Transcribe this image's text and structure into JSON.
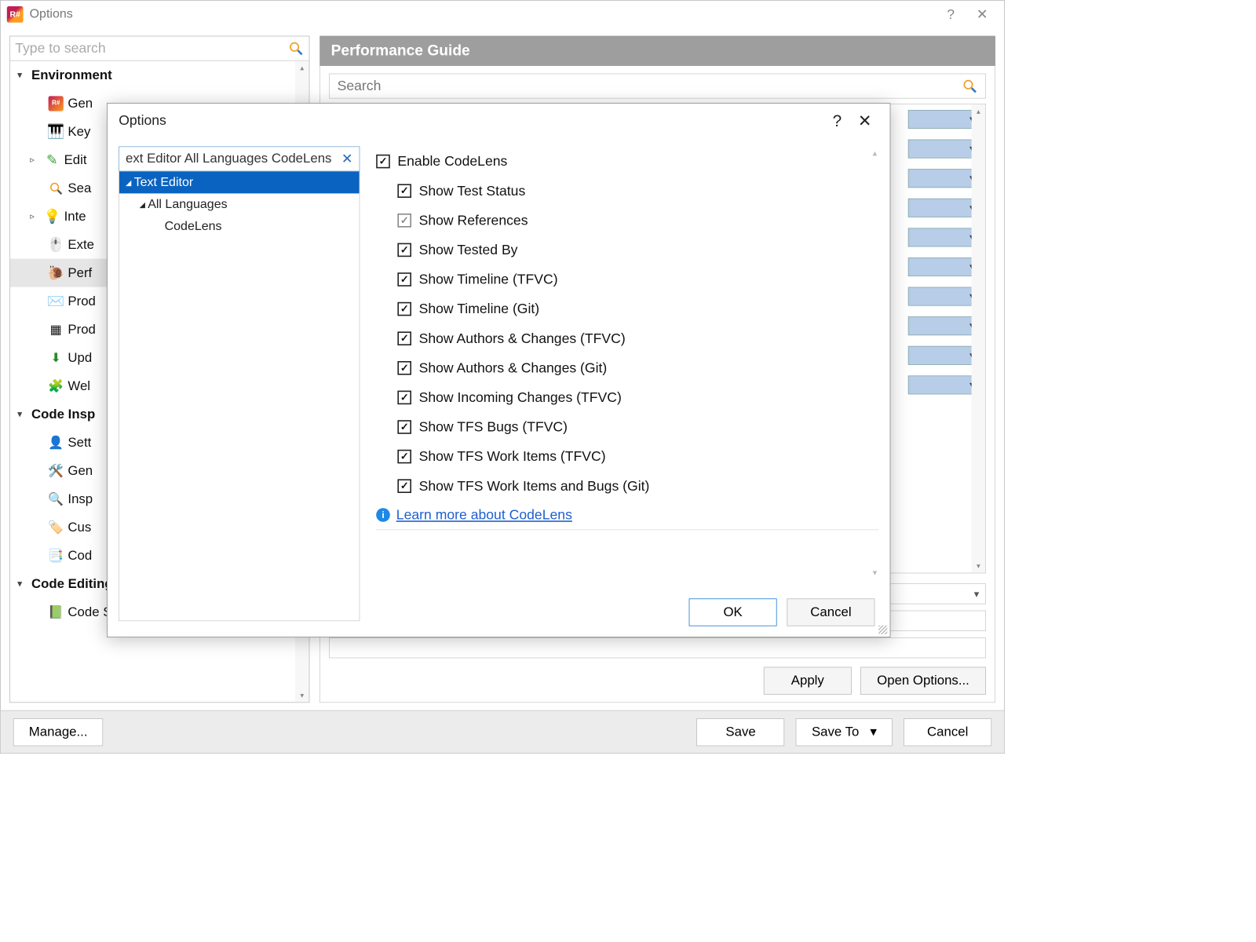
{
  "outer": {
    "title": "Options",
    "search_placeholder": "Type to search",
    "panel_title": "Performance Guide",
    "panel_search_placeholder": "Search",
    "apply": "Apply",
    "open_options": "Open Options...",
    "manage": "Manage...",
    "save": "Save",
    "save_to": "Save To",
    "cancel": "Cancel"
  },
  "tree": [
    {
      "label": "Environment",
      "level": 1,
      "expander": "▾"
    },
    {
      "label": "Gen",
      "level": 2,
      "icon": "r#",
      "truncated": true
    },
    {
      "label": "Key",
      "level": 2,
      "icon": "keys",
      "truncated": true
    },
    {
      "label": "Edit",
      "level": 2,
      "icon": "pencil",
      "expander": "▹",
      "truncated": true
    },
    {
      "label": "Sea",
      "level": 2,
      "icon": "search",
      "truncated": true
    },
    {
      "label": "Inte",
      "level": 2,
      "icon": "bulb",
      "expander": "▹",
      "truncated": true
    },
    {
      "label": "Exte",
      "level": 2,
      "icon": "mouse",
      "truncated": true
    },
    {
      "label": "Perf",
      "level": 2,
      "icon": "snail",
      "selected": true,
      "truncated": true
    },
    {
      "label": "Prod",
      "level": 2,
      "icon": "mail",
      "truncated": true
    },
    {
      "label": "Prod",
      "level": 2,
      "icon": "grid",
      "truncated": true
    },
    {
      "label": "Upd",
      "level": 2,
      "icon": "download",
      "truncated": true
    },
    {
      "label": "Wel",
      "level": 2,
      "icon": "puzzle",
      "truncated": true
    },
    {
      "label": "Code Insp",
      "level": 1,
      "expander": "▾",
      "truncated": true
    },
    {
      "label": "Sett",
      "level": 2,
      "icon": "user",
      "truncated": true
    },
    {
      "label": "Gen",
      "level": 2,
      "icon": "tools",
      "truncated": true
    },
    {
      "label": "Insp",
      "level": 2,
      "icon": "inspect",
      "truncated": true
    },
    {
      "label": "Cus",
      "level": 2,
      "icon": "tag",
      "truncated": true
    },
    {
      "label": "Cod",
      "level": 2,
      "icon": "code",
      "truncated": true
    },
    {
      "label": "Code Editing",
      "level": 1,
      "expander": "▾",
      "truncated": true
    },
    {
      "label": "Code Style Sharing",
      "level": 2,
      "icon": "share"
    }
  ],
  "modal": {
    "title": "Options",
    "search_value": "ext Editor All Languages CodeLens",
    "tree": [
      {
        "label": "Text Editor",
        "level": 1,
        "expanded": true,
        "selected": true
      },
      {
        "label": "All Languages",
        "level": 2,
        "expanded": true
      },
      {
        "label": "CodeLens",
        "level": 3
      }
    ],
    "options": [
      {
        "label": "Enable CodeLens",
        "checked": true,
        "indent": false
      },
      {
        "label": "Show Test Status",
        "checked": true,
        "indent": true
      },
      {
        "label": "Show References",
        "checked": true,
        "indent": true,
        "grey": true
      },
      {
        "label": "Show Tested By",
        "checked": true,
        "indent": true
      },
      {
        "label": "Show Timeline (TFVC)",
        "checked": true,
        "indent": true
      },
      {
        "label": "Show Timeline (Git)",
        "checked": true,
        "indent": true
      },
      {
        "label": "Show Authors & Changes (TFVC)",
        "checked": true,
        "indent": true
      },
      {
        "label": "Show Authors & Changes (Git)",
        "checked": true,
        "indent": true
      },
      {
        "label": "Show Incoming Changes (TFVC)",
        "checked": true,
        "indent": true
      },
      {
        "label": "Show TFS Bugs (TFVC)",
        "checked": true,
        "indent": true
      },
      {
        "label": "Show TFS Work Items (TFVC)",
        "checked": true,
        "indent": true
      },
      {
        "label": "Show TFS Work Items and Bugs (Git)",
        "checked": true,
        "indent": true
      }
    ],
    "learn_more": "Learn more about CodeLens",
    "ok": "OK",
    "cancel": "Cancel"
  }
}
